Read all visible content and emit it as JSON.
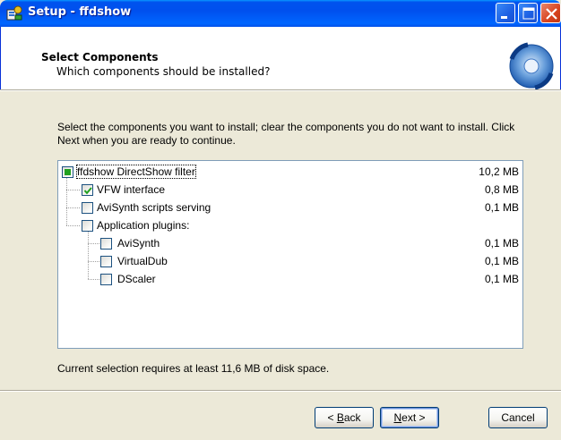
{
  "window": {
    "title": "Setup - ffdshow",
    "icon": "setup-installer-icon"
  },
  "header": {
    "title": "Select Components",
    "subtitle": "Which components should be installed?",
    "graphic": "cd-install-graphic"
  },
  "instructions": "Select the components you want to install; clear the components you do not want to install. Click Next when you are ready to continue.",
  "components": [
    {
      "label": "ffdshow DirectShow filter",
      "size": "10,2 MB",
      "state": "partial",
      "level": 0
    },
    {
      "label": "VFW interface",
      "size": "0,8 MB",
      "state": "checked",
      "level": 1
    },
    {
      "label": "AviSynth scripts serving",
      "size": "0,1 MB",
      "state": "unchecked",
      "level": 1
    },
    {
      "label": "Application plugins:",
      "size": "",
      "state": "unchecked",
      "level": 1
    },
    {
      "label": "AviSynth",
      "size": "0,1 MB",
      "state": "unchecked",
      "level": 2
    },
    {
      "label": "VirtualDub",
      "size": "0,1 MB",
      "state": "unchecked",
      "level": 2
    },
    {
      "label": "DScaler",
      "size": "0,1 MB",
      "state": "unchecked",
      "level": 2
    }
  ],
  "disk_requirement": "Current selection requires at least 11,6 MB of disk space.",
  "buttons": {
    "back_prefix": "< ",
    "back_key": "B",
    "back_rest": "ack",
    "next_key": "N",
    "next_rest": "ext >",
    "cancel": "Cancel"
  },
  "colors": {
    "titlebar": "#0054E3",
    "dialog_bg": "#ECE9D8",
    "partial_check": "#21A121",
    "check_mark": "#21A121"
  }
}
